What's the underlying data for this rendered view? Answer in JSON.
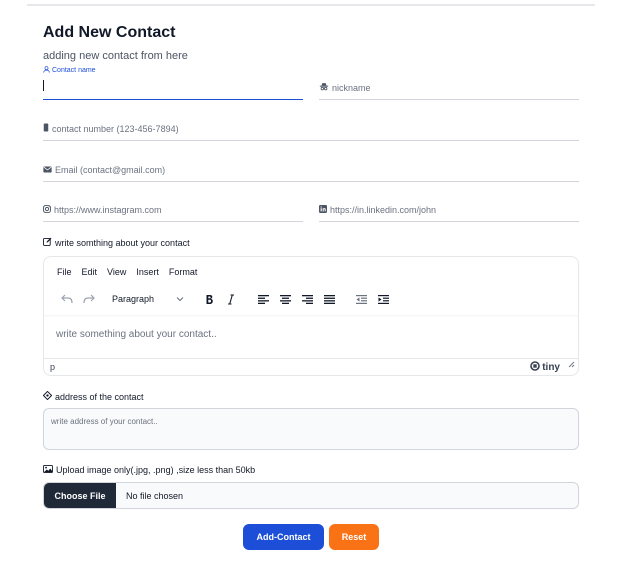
{
  "page": {
    "title": "Add New Contact",
    "subtitle": "adding new contact from here"
  },
  "form": {
    "contact_name": {
      "label": "Contact name",
      "value": "",
      "icon": "user-icon"
    },
    "nickname": {
      "placeholder": "nickname",
      "icon": "user-secret-icon"
    },
    "contact_number": {
      "placeholder": "contact number (123-456-7894)",
      "icon": "phone-icon"
    },
    "email": {
      "placeholder": "Email (contact@gmail.com)",
      "icon": "envelope-icon"
    },
    "instagram": {
      "placeholder": "https://www.instagram.com",
      "icon": "instagram-icon"
    },
    "linkedin": {
      "placeholder": "https://in.linkedin.com/john",
      "icon": "linkedin-icon"
    },
    "about": {
      "label": "write somthing about your contact",
      "icon": "edit-icon",
      "menu": [
        "File",
        "Edit",
        "View",
        "Insert",
        "Format"
      ],
      "block_format": "Paragraph",
      "placeholder": "write something about your contact..",
      "status_path": "p",
      "brand": "tiny"
    },
    "address": {
      "label": "address of the contact",
      "icon": "location-icon",
      "placeholder": "write address of your contact.."
    },
    "image": {
      "label": "Upload image only(.jpg, .png) ,size less than 50kb",
      "icon": "image-icon",
      "button": "Choose File",
      "file_name": "No file chosen"
    }
  },
  "actions": {
    "submit": "Add-Contact",
    "reset": "Reset"
  },
  "colors": {
    "primary": "#1d4ed8",
    "reset": "#f97316",
    "file_button": "#1f2937"
  }
}
